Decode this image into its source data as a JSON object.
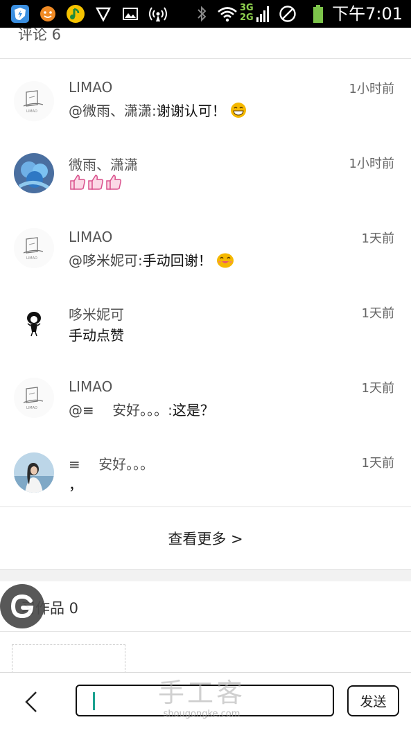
{
  "status_bar": {
    "time": "下午7:01",
    "network_top": "3G",
    "network_bottom": "2G"
  },
  "comments_section": {
    "title": "评论 6",
    "comments": [
      {
        "user": "LIMAO",
        "time": "1小时前",
        "prefix": "@微雨、潇潇:",
        "text": "谢谢认可！",
        "emoji": "grinning-emoji"
      },
      {
        "user": "微雨、潇潇",
        "time": "1小时前",
        "prefix": "",
        "text": "",
        "emoji": "thumbs-up-emoji x3"
      },
      {
        "user": "LIMAO",
        "time": "1天前",
        "prefix": "@哆米妮可:",
        "text": "手动回谢！",
        "emoji": "smiling-emoji"
      },
      {
        "user": "哆米妮可",
        "time": "1天前",
        "prefix": "",
        "text": "手动点赞",
        "emoji": ""
      },
      {
        "user": "LIMAO",
        "time": "1天前",
        "prefix": "@≡　 安好。。。:",
        "text": "这是？",
        "emoji": ""
      },
      {
        "user": "≡　 安好。。。",
        "time": "1天前",
        "prefix": "",
        "text": "，",
        "emoji": ""
      }
    ],
    "view_more": "查看更多 >"
  },
  "works_section": {
    "title": "习作品 0"
  },
  "bottom_bar": {
    "input_value": "",
    "send_label": "发送"
  },
  "watermark": {
    "cn": "手工客",
    "en": "shougongke.com"
  },
  "colors": {
    "status_bar_bg": "#000000",
    "caret": "#1aa18f",
    "emoji_yellow": "#f5b800",
    "thumb_pink": "#d9508c"
  }
}
